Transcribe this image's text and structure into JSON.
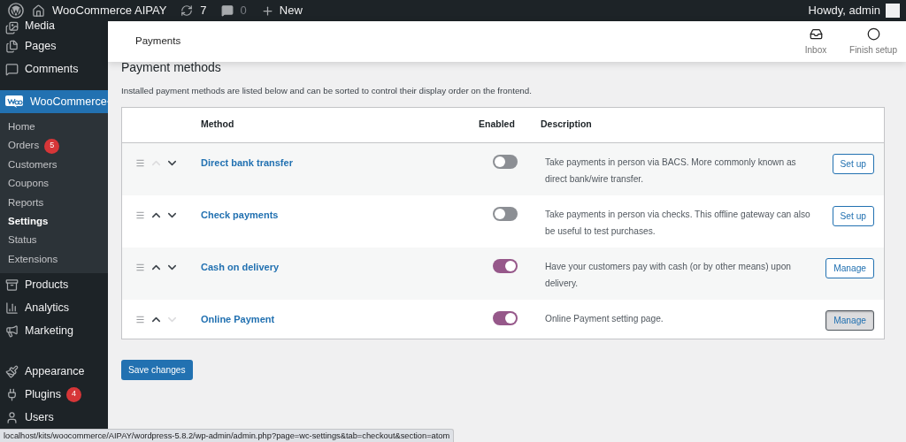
{
  "admin_bar": {
    "site_name": "WooCommerce AIPAY",
    "updates": "7",
    "comments": "0",
    "new": "New",
    "greeting": "Howdy, admin"
  },
  "sidebar": {
    "groups": [
      [
        {
          "label": "Media",
          "selected": false
        },
        {
          "label": "Pages",
          "selected": false
        },
        {
          "label": "Comments",
          "selected": false
        }
      ],
      [
        {
          "label": "WooCommerce",
          "selected": true,
          "children": [
            {
              "label": "Home",
              "selected": false
            },
            {
              "label": "Orders",
              "selected": false,
              "badge": "5"
            },
            {
              "label": "Customers",
              "selected": false
            },
            {
              "label": "Coupons",
              "selected": false
            },
            {
              "label": "Reports",
              "selected": false
            },
            {
              "label": "Settings",
              "selected": true
            },
            {
              "label": "Status",
              "selected": false
            },
            {
              "label": "Extensions",
              "selected": false
            }
          ]
        },
        {
          "label": "Products",
          "selected": false
        },
        {
          "label": "Analytics",
          "selected": false
        },
        {
          "label": "Marketing",
          "selected": false
        }
      ],
      [
        {
          "label": "Appearance",
          "selected": false
        },
        {
          "label": "Plugins",
          "selected": false,
          "badge": "4"
        },
        {
          "label": "Users",
          "selected": false
        }
      ]
    ]
  },
  "header": {
    "title": "Payments",
    "actions": [
      "Inbox",
      "Finish setup"
    ]
  },
  "section": {
    "heading": "Payment methods",
    "description": "Installed payment methods are listed below and can be sorted to control their display order on the frontend."
  },
  "table": {
    "columns": [
      "Method",
      "Enabled",
      "Description"
    ],
    "rows": [
      {
        "name": "Direct bank transfer",
        "enabled": false,
        "description": "Take payments in person via BACS. More commonly known as direct bank/wire transfer.",
        "action": {
          "label": "Set up",
          "highlighted": false
        },
        "up_disabled": true,
        "down_disabled": false
      },
      {
        "name": "Check payments",
        "enabled": false,
        "description": "Take payments in person via checks. This offline gateway can also be useful to test purchases.",
        "action": {
          "label": "Set up",
          "highlighted": false
        },
        "up_disabled": false,
        "down_disabled": false
      },
      {
        "name": "Cash on delivery",
        "enabled": true,
        "description": "Have your customers pay with cash (or by other means) upon delivery.",
        "action": {
          "label": "Manage",
          "highlighted": false
        },
        "up_disabled": false,
        "down_disabled": false
      },
      {
        "name": "Online Payment",
        "enabled": true,
        "description": "Online Payment setting page.",
        "action": {
          "label": "Manage",
          "highlighted": true
        },
        "up_disabled": false,
        "down_disabled": true
      }
    ]
  },
  "save_button": "Save changes",
  "status_url": "localhost/kits/woocommerce/AIPAY/wordpress-5.8.2/wp-admin/admin.php?page=wc-settings&tab=checkout&section=atom"
}
